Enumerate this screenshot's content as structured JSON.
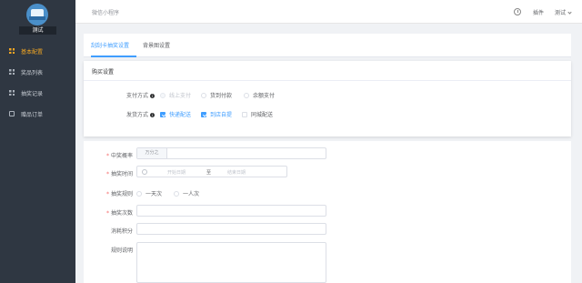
{
  "sidebar": {
    "store_name": "测试",
    "items": [
      {
        "label": "基本配置",
        "icon": "grid-icon",
        "active": true
      },
      {
        "label": "奖品列表",
        "icon": "grid-icon",
        "active": false
      },
      {
        "label": "抽奖记录",
        "icon": "grid-icon",
        "active": false
      },
      {
        "label": "赠品订单",
        "icon": "file-icon",
        "active": false
      }
    ]
  },
  "header": {
    "app_label": "微信小程序",
    "help_label": "插件",
    "user_label": "测试"
  },
  "tabs": [
    {
      "label": "刮刮卡抽奖设置",
      "active": true
    },
    {
      "label": "背景图设置",
      "active": false
    }
  ],
  "buy_settings": {
    "title": "购买设置",
    "payment": {
      "label": "支付方式",
      "options": [
        {
          "label": "线上支付",
          "state": "disabled"
        },
        {
          "label": "货到付款",
          "state": "unselected"
        },
        {
          "label": "余额支付",
          "state": "unselected"
        }
      ]
    },
    "delivery": {
      "label": "发货方式",
      "options": [
        {
          "label": "快递配送",
          "checked": true
        },
        {
          "label": "到店自提",
          "checked": true
        },
        {
          "label": "同城配送",
          "checked": false
        }
      ]
    }
  },
  "form": {
    "win_rate": {
      "label": "中奖概率",
      "required": true,
      "prefix": "万分之",
      "value": ""
    },
    "lottery_time": {
      "label": "抽奖时间",
      "required": true,
      "start_placeholder": "开始日期",
      "separator": "至",
      "end_placeholder": "结束日期"
    },
    "lottery_rule": {
      "label": "抽奖规则",
      "required": true,
      "options": [
        "一天次",
        "一人次"
      ]
    },
    "lottery_count": {
      "label": "抽奖次数",
      "required": true,
      "value": ""
    },
    "points_cost": {
      "label": "消耗积分",
      "required": false,
      "value": ""
    },
    "rules_desc": {
      "label": "规则说明",
      "required": false,
      "value": ""
    }
  },
  "colors": {
    "sidebar_bg": "#2f3742",
    "active_orange": "#f1a623",
    "primary_blue": "#409eff",
    "required_red": "#f56c6c"
  }
}
